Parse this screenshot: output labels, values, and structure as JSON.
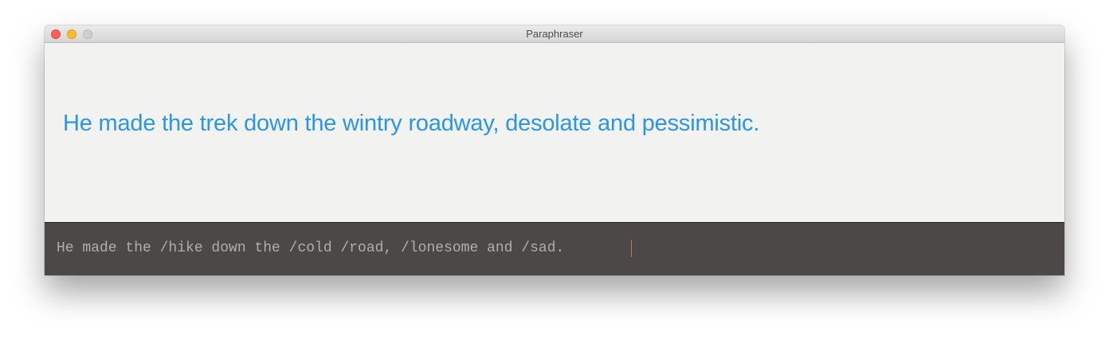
{
  "window": {
    "title": "Paraphraser"
  },
  "output": {
    "text": "He made the trek down the wintry roadway, desolate and pessimistic."
  },
  "input": {
    "text": "He made the /hike down the /cold /road, /lonesome and /sad."
  },
  "colors": {
    "output_text": "#2b95e8",
    "input_bg": "#4c4847",
    "caret": "#d46b5f"
  }
}
